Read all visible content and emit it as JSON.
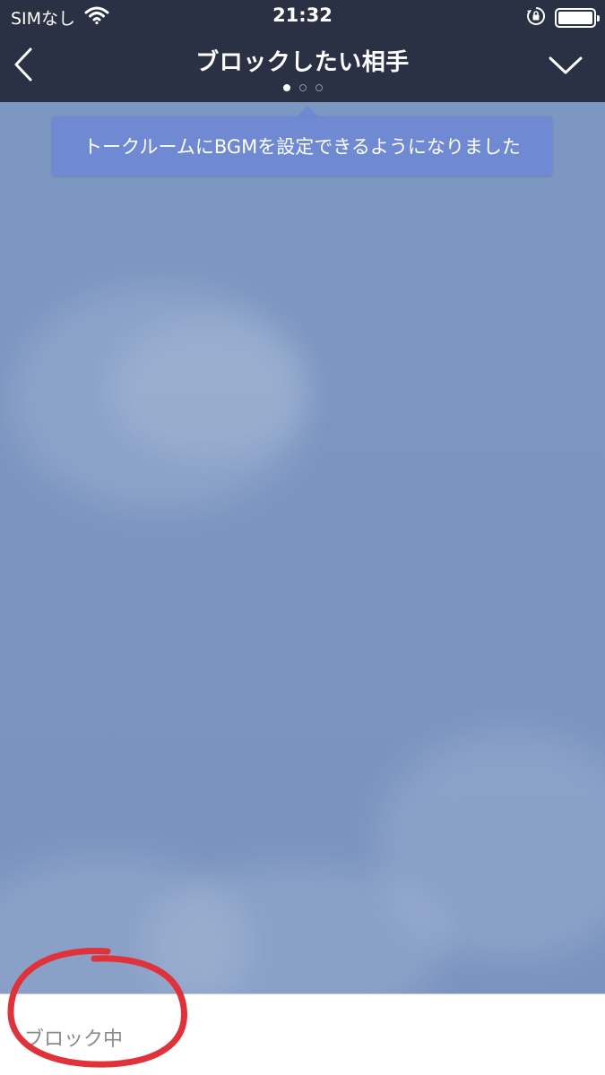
{
  "status_bar": {
    "carrier": "SIMなし",
    "time": "21:32",
    "icons": [
      "wifi-icon",
      "orientation-lock-icon",
      "battery-icon"
    ],
    "battery_level": 1.0
  },
  "nav": {
    "title": "ブロックしたい相手",
    "back_icon": "chevron-left-icon",
    "menu_icon": "chevron-down-icon",
    "page_count": 3,
    "active_page": 1
  },
  "tooltip": {
    "text": "トークルームにBGMを設定できるようになりました"
  },
  "footer": {
    "status_text": "ブロック中"
  },
  "colors": {
    "header_bg": "#2b3145",
    "chat_bg": "#7d97c3",
    "tooltip_bg": "#6f89d3",
    "annotation": "#e0323a"
  }
}
